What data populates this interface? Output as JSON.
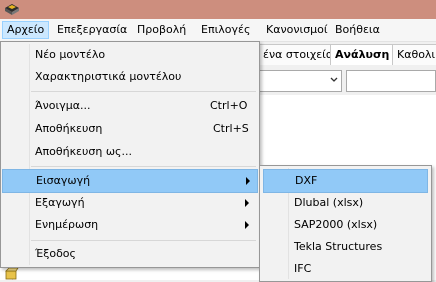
{
  "app": {
    "icon": "app-logo-icon"
  },
  "menubar": {
    "items": [
      {
        "label": "Αρχείο",
        "active": true
      },
      {
        "label": "Επεξεργασία"
      },
      {
        "label": "Προβολή"
      },
      {
        "label": "Επιλογές"
      },
      {
        "label": "Κανονισμοί"
      },
      {
        "label": "Βοήθεια"
      }
    ]
  },
  "tabs": [
    {
      "label": "ένα στοιχεία"
    },
    {
      "label": "Ανάλυση"
    },
    {
      "label": "Καθολι"
    }
  ],
  "file_menu": {
    "items": [
      {
        "label": "Νέο μοντέλο"
      },
      {
        "label": "Χαρακτηριστικά μοντέλου"
      },
      {
        "label": "Άνοιγμα...",
        "shortcut": "Ctrl+O"
      },
      {
        "label": "Αποθήκευση",
        "shortcut": "Ctrl+S"
      },
      {
        "label": "Αποθήκευση ως..."
      },
      {
        "label": "Εισαγωγή",
        "submenu": true
      },
      {
        "label": "Εξαγωγή",
        "submenu": true
      },
      {
        "label": "Ενημέρωση",
        "submenu": true
      },
      {
        "label": "Έξοδος"
      }
    ]
  },
  "import_submenu": {
    "items": [
      {
        "label": "DXF"
      },
      {
        "label": "Dlubal (xlsx)"
      },
      {
        "label": "SAP2000 (xlsx)"
      },
      {
        "label": "Tekla Structures"
      },
      {
        "label": "IFC"
      }
    ]
  },
  "colors": {
    "titlebar": "#cd8e7e",
    "menu_highlight": "#91c9f7",
    "menubar_active": "#cce8ff"
  }
}
